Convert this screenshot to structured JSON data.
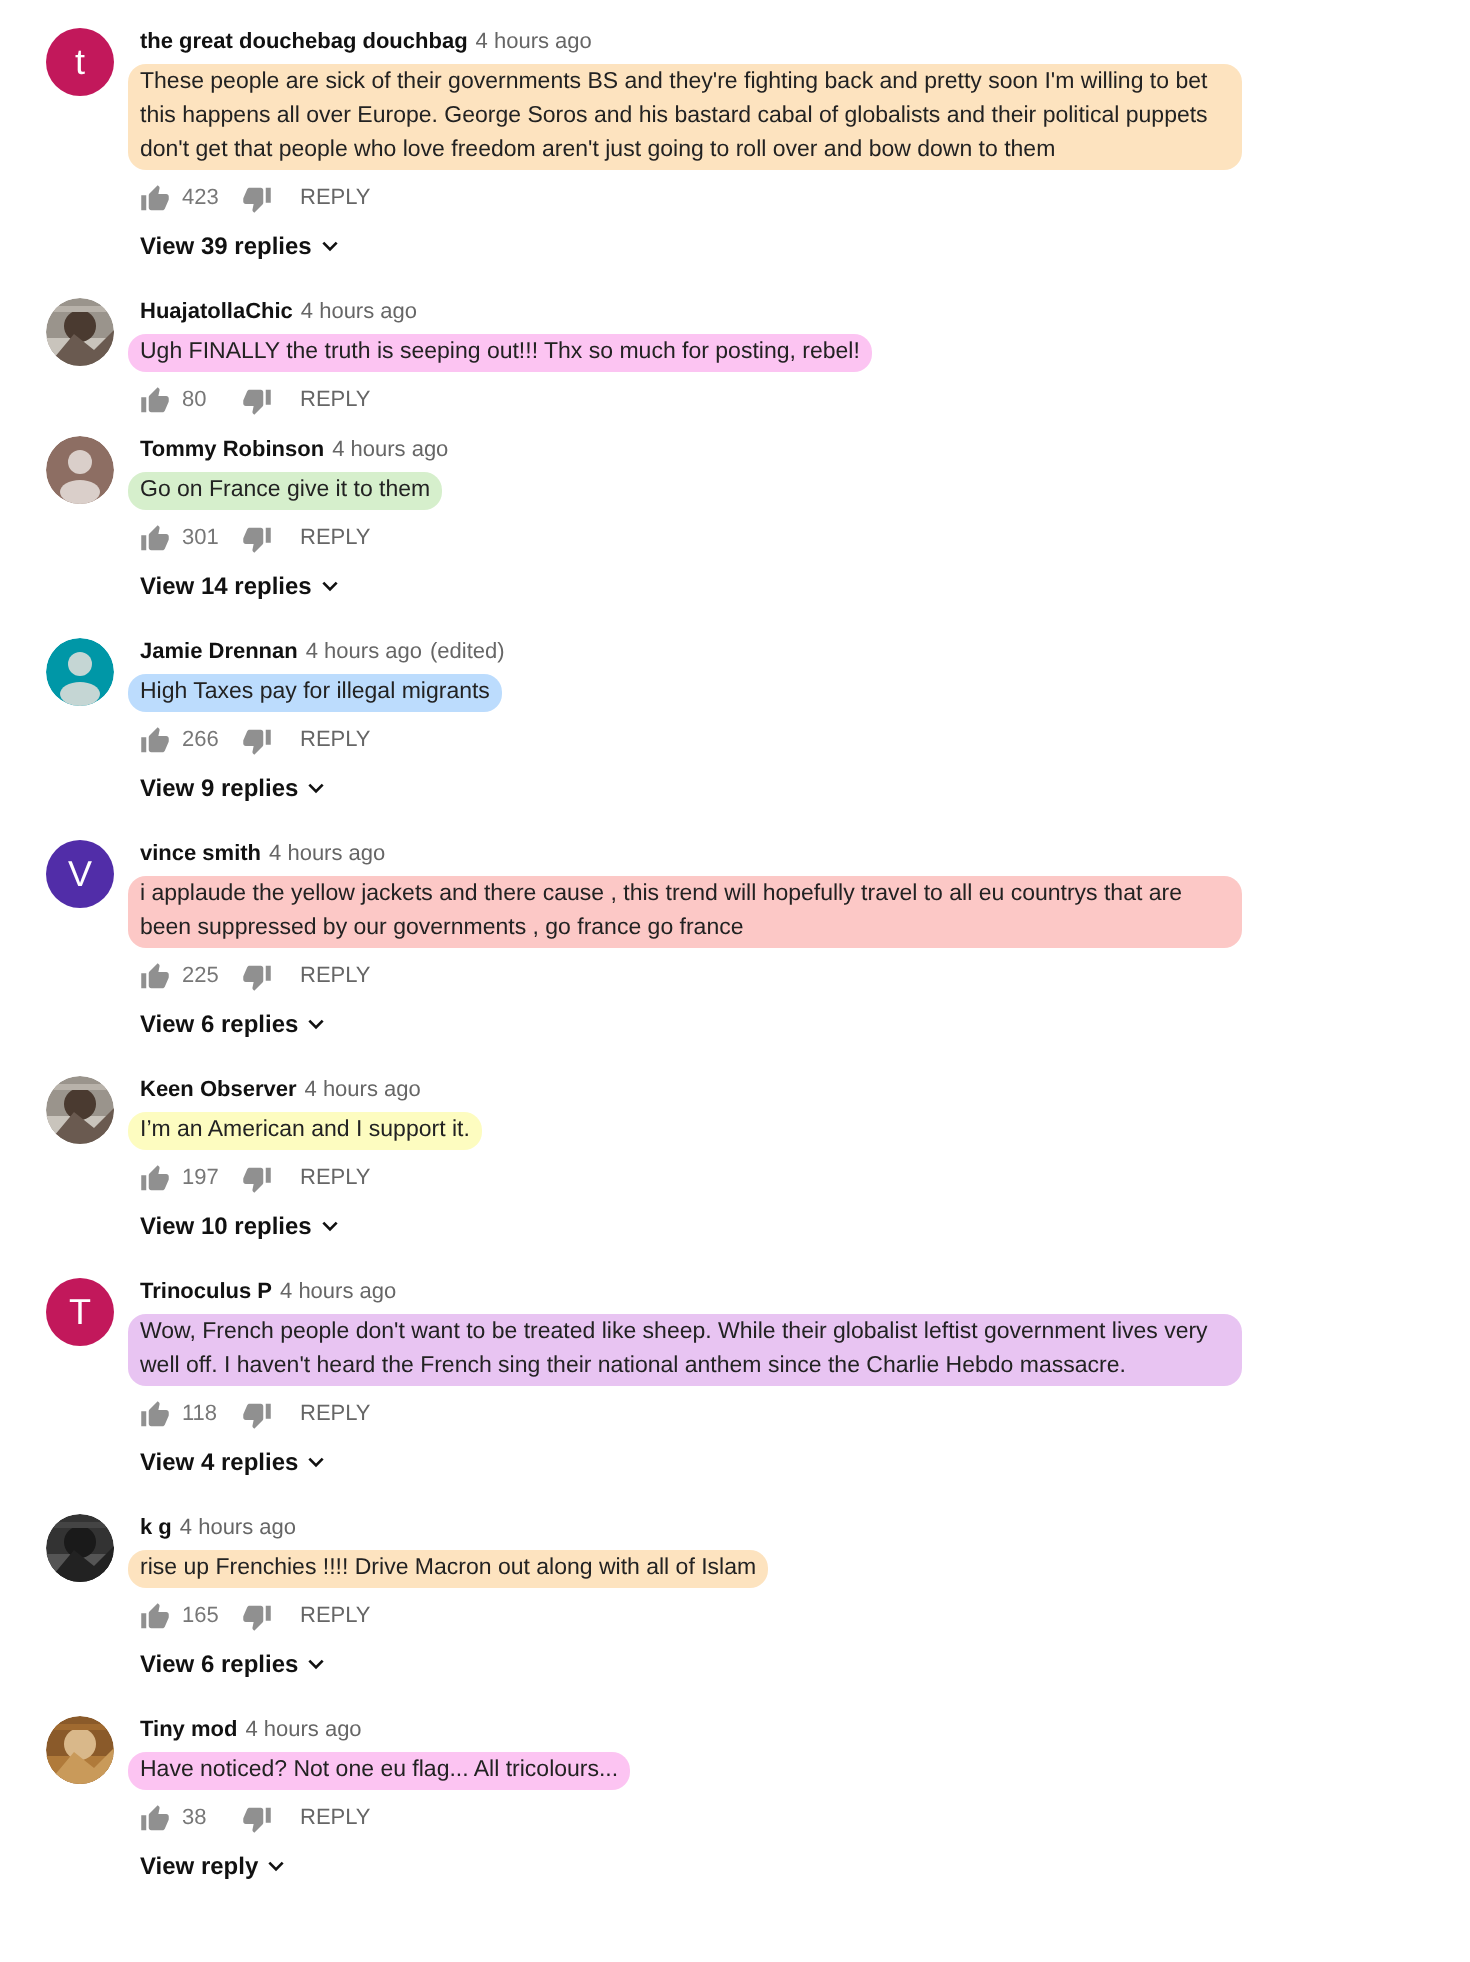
{
  "comments": [
    {
      "author": "the great douchebag douchbag",
      "time": "4 hours ago",
      "avatar": {
        "kind": "letter",
        "letter": "t",
        "color": "#c2185b"
      },
      "text": "These people are sick of their governments BS and they're fighting back and pretty soon I'm willing to bet this happens all over Europe. George Soros and his bastard cabal of globalists and their political puppets don't get that people who love freedom aren't just going to roll over and bow down to them",
      "color": "#fde3bf",
      "likes": "423",
      "reply": "REPLY",
      "view_replies": "View 39 replies"
    },
    {
      "author": "HuajatollaChic",
      "time": "4 hours ago",
      "text": "Ugh FINALLY the truth is seeping out!!! Thx so much for posting, rebel!",
      "color": "#fcc4f2",
      "likes": "80",
      "reply": "REPLY"
    },
    {
      "author": "Tommy Robinson",
      "time": "4 hours ago",
      "avatar": {
        "kind": "silhouette",
        "color": "#8d6e63"
      },
      "text": "Go on France give it to them",
      "color": "#d6efcc",
      "likes": "301",
      "reply": "REPLY",
      "view_replies": "View 14 replies"
    },
    {
      "author": "Jamie Drennan",
      "time": "4 hours ago",
      "edited": "(edited)",
      "avatar": {
        "kind": "silhouette",
        "color": "#0097a7"
      },
      "text": "High Taxes pay for illegal migrants",
      "color": "#bcdcfd",
      "likes": "266",
      "reply": "REPLY",
      "view_replies": "View 9 replies"
    },
    {
      "author": "vince smith",
      "time": "4 hours ago",
      "avatar": {
        "kind": "letter",
        "letter": "V",
        "color": "#512da8"
      },
      "text": "i applaude the yellow jackets  and there cause , this trend will hopefully travel to all eu countrys that are been suppressed by our governments , go france go france",
      "color": "#fcc8c6",
      "likes": "225",
      "reply": "REPLY",
      "view_replies": "View 6 replies"
    },
    {
      "author": "Keen Observer",
      "time": "4 hours ago",
      "text": "I’m an American and I support it.",
      "color": "#fdfcc0",
      "likes": "197",
      "reply": "REPLY",
      "view_replies": "View 10 replies"
    },
    {
      "author": "Trinoculus P",
      "time": "4 hours ago",
      "avatar": {
        "kind": "letter",
        "letter": "T",
        "color": "#c2185b"
      },
      "text": "Wow, French people don't want to be treated like sheep. While their globalist leftist government lives very well off. I haven't heard the French sing their national anthem since the Charlie Hebdo massacre.",
      "color": "#e8c4f2",
      "likes": "118",
      "reply": "REPLY",
      "view_replies": "View 4 replies"
    },
    {
      "author": "k g",
      "time": "4 hours ago",
      "text": "rise up Frenchies !!!! Drive Macron out along with all of Islam",
      "color": "#fde3bf",
      "likes": "165",
      "reply": "REPLY",
      "view_replies": "View 6 replies"
    },
    {
      "author": "Tiny mod",
      "time": "4 hours ago",
      "text": "Have noticed? Not one eu flag... All tricolours...",
      "color": "#fcc4f2",
      "likes": "38",
      "reply": "REPLY",
      "view_replies": "View reply"
    }
  ]
}
